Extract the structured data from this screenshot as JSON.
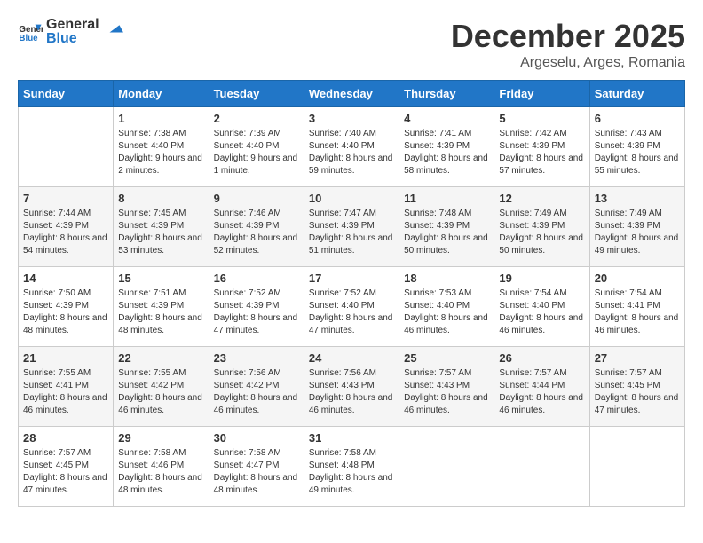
{
  "logo": {
    "text_general": "General",
    "text_blue": "Blue"
  },
  "header": {
    "month": "December 2025",
    "location": "Argeselu, Arges, Romania"
  },
  "weekdays": [
    "Sunday",
    "Monday",
    "Tuesday",
    "Wednesday",
    "Thursday",
    "Friday",
    "Saturday"
  ],
  "weeks": [
    [
      {
        "day": "",
        "sunrise": "",
        "sunset": "",
        "daylight": ""
      },
      {
        "day": "1",
        "sunrise": "Sunrise: 7:38 AM",
        "sunset": "Sunset: 4:40 PM",
        "daylight": "Daylight: 9 hours and 2 minutes."
      },
      {
        "day": "2",
        "sunrise": "Sunrise: 7:39 AM",
        "sunset": "Sunset: 4:40 PM",
        "daylight": "Daylight: 9 hours and 1 minute."
      },
      {
        "day": "3",
        "sunrise": "Sunrise: 7:40 AM",
        "sunset": "Sunset: 4:40 PM",
        "daylight": "Daylight: 8 hours and 59 minutes."
      },
      {
        "day": "4",
        "sunrise": "Sunrise: 7:41 AM",
        "sunset": "Sunset: 4:39 PM",
        "daylight": "Daylight: 8 hours and 58 minutes."
      },
      {
        "day": "5",
        "sunrise": "Sunrise: 7:42 AM",
        "sunset": "Sunset: 4:39 PM",
        "daylight": "Daylight: 8 hours and 57 minutes."
      },
      {
        "day": "6",
        "sunrise": "Sunrise: 7:43 AM",
        "sunset": "Sunset: 4:39 PM",
        "daylight": "Daylight: 8 hours and 55 minutes."
      }
    ],
    [
      {
        "day": "7",
        "sunrise": "Sunrise: 7:44 AM",
        "sunset": "Sunset: 4:39 PM",
        "daylight": "Daylight: 8 hours and 54 minutes."
      },
      {
        "day": "8",
        "sunrise": "Sunrise: 7:45 AM",
        "sunset": "Sunset: 4:39 PM",
        "daylight": "Daylight: 8 hours and 53 minutes."
      },
      {
        "day": "9",
        "sunrise": "Sunrise: 7:46 AM",
        "sunset": "Sunset: 4:39 PM",
        "daylight": "Daylight: 8 hours and 52 minutes."
      },
      {
        "day": "10",
        "sunrise": "Sunrise: 7:47 AM",
        "sunset": "Sunset: 4:39 PM",
        "daylight": "Daylight: 8 hours and 51 minutes."
      },
      {
        "day": "11",
        "sunrise": "Sunrise: 7:48 AM",
        "sunset": "Sunset: 4:39 PM",
        "daylight": "Daylight: 8 hours and 50 minutes."
      },
      {
        "day": "12",
        "sunrise": "Sunrise: 7:49 AM",
        "sunset": "Sunset: 4:39 PM",
        "daylight": "Daylight: 8 hours and 50 minutes."
      },
      {
        "day": "13",
        "sunrise": "Sunrise: 7:49 AM",
        "sunset": "Sunset: 4:39 PM",
        "daylight": "Daylight: 8 hours and 49 minutes."
      }
    ],
    [
      {
        "day": "14",
        "sunrise": "Sunrise: 7:50 AM",
        "sunset": "Sunset: 4:39 PM",
        "daylight": "Daylight: 8 hours and 48 minutes."
      },
      {
        "day": "15",
        "sunrise": "Sunrise: 7:51 AM",
        "sunset": "Sunset: 4:39 PM",
        "daylight": "Daylight: 8 hours and 48 minutes."
      },
      {
        "day": "16",
        "sunrise": "Sunrise: 7:52 AM",
        "sunset": "Sunset: 4:39 PM",
        "daylight": "Daylight: 8 hours and 47 minutes."
      },
      {
        "day": "17",
        "sunrise": "Sunrise: 7:52 AM",
        "sunset": "Sunset: 4:40 PM",
        "daylight": "Daylight: 8 hours and 47 minutes."
      },
      {
        "day": "18",
        "sunrise": "Sunrise: 7:53 AM",
        "sunset": "Sunset: 4:40 PM",
        "daylight": "Daylight: 8 hours and 46 minutes."
      },
      {
        "day": "19",
        "sunrise": "Sunrise: 7:54 AM",
        "sunset": "Sunset: 4:40 PM",
        "daylight": "Daylight: 8 hours and 46 minutes."
      },
      {
        "day": "20",
        "sunrise": "Sunrise: 7:54 AM",
        "sunset": "Sunset: 4:41 PM",
        "daylight": "Daylight: 8 hours and 46 minutes."
      }
    ],
    [
      {
        "day": "21",
        "sunrise": "Sunrise: 7:55 AM",
        "sunset": "Sunset: 4:41 PM",
        "daylight": "Daylight: 8 hours and 46 minutes."
      },
      {
        "day": "22",
        "sunrise": "Sunrise: 7:55 AM",
        "sunset": "Sunset: 4:42 PM",
        "daylight": "Daylight: 8 hours and 46 minutes."
      },
      {
        "day": "23",
        "sunrise": "Sunrise: 7:56 AM",
        "sunset": "Sunset: 4:42 PM",
        "daylight": "Daylight: 8 hours and 46 minutes."
      },
      {
        "day": "24",
        "sunrise": "Sunrise: 7:56 AM",
        "sunset": "Sunset: 4:43 PM",
        "daylight": "Daylight: 8 hours and 46 minutes."
      },
      {
        "day": "25",
        "sunrise": "Sunrise: 7:57 AM",
        "sunset": "Sunset: 4:43 PM",
        "daylight": "Daylight: 8 hours and 46 minutes."
      },
      {
        "day": "26",
        "sunrise": "Sunrise: 7:57 AM",
        "sunset": "Sunset: 4:44 PM",
        "daylight": "Daylight: 8 hours and 46 minutes."
      },
      {
        "day": "27",
        "sunrise": "Sunrise: 7:57 AM",
        "sunset": "Sunset: 4:45 PM",
        "daylight": "Daylight: 8 hours and 47 minutes."
      }
    ],
    [
      {
        "day": "28",
        "sunrise": "Sunrise: 7:57 AM",
        "sunset": "Sunset: 4:45 PM",
        "daylight": "Daylight: 8 hours and 47 minutes."
      },
      {
        "day": "29",
        "sunrise": "Sunrise: 7:58 AM",
        "sunset": "Sunset: 4:46 PM",
        "daylight": "Daylight: 8 hours and 48 minutes."
      },
      {
        "day": "30",
        "sunrise": "Sunrise: 7:58 AM",
        "sunset": "Sunset: 4:47 PM",
        "daylight": "Daylight: 8 hours and 48 minutes."
      },
      {
        "day": "31",
        "sunrise": "Sunrise: 7:58 AM",
        "sunset": "Sunset: 4:48 PM",
        "daylight": "Daylight: 8 hours and 49 minutes."
      },
      {
        "day": "",
        "sunrise": "",
        "sunset": "",
        "daylight": ""
      },
      {
        "day": "",
        "sunrise": "",
        "sunset": "",
        "daylight": ""
      },
      {
        "day": "",
        "sunrise": "",
        "sunset": "",
        "daylight": ""
      }
    ]
  ]
}
